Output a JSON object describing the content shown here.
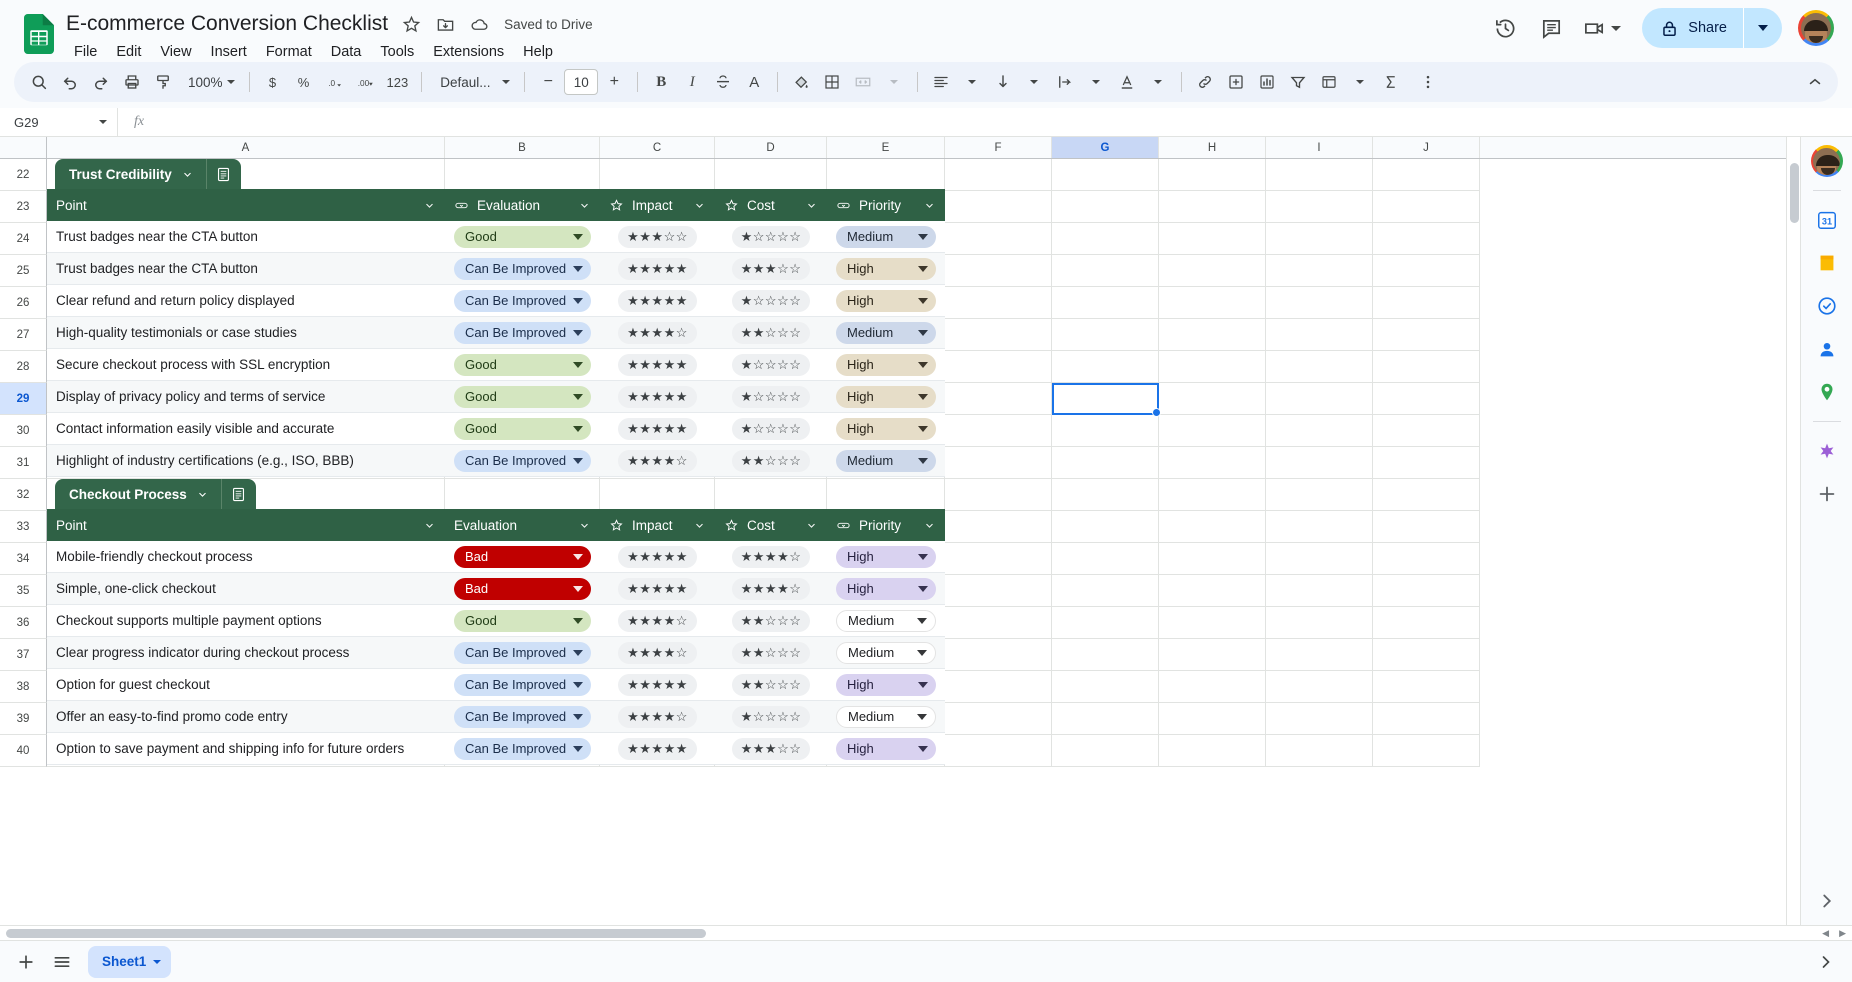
{
  "app": {
    "doc_title": "E-commerce Conversion Checklist",
    "save_status": "Saved to Drive",
    "menus": [
      "File",
      "Edit",
      "View",
      "Insert",
      "Format",
      "Data",
      "Tools",
      "Extensions",
      "Help"
    ],
    "share_label": "Share"
  },
  "toolbar": {
    "zoom": "100%",
    "font": "Defaul...",
    "font_size": "10",
    "number_123": "123",
    "currency": "$",
    "percent": "%",
    "dec_dec": ".0",
    "dec_inc": ".00",
    "bold": "B",
    "italic": "I",
    "text_color": "A",
    "minus": "−",
    "plus": "+"
  },
  "formula_bar": {
    "cell_ref": "G29",
    "formula": ""
  },
  "grid": {
    "columns": [
      "A",
      "B",
      "C",
      "D",
      "E",
      "F",
      "G",
      "H",
      "I",
      "J"
    ],
    "highlighted_column": "G",
    "selected_cell": "G29",
    "rows": [
      "22",
      "23",
      "24",
      "25",
      "26",
      "27",
      "28",
      "29",
      "30",
      "31",
      "32",
      "33",
      "34",
      "35",
      "36",
      "37",
      "38",
      "39",
      "40"
    ],
    "highlighted_row": "29"
  },
  "tables": [
    {
      "name": "Trust Credibility",
      "start_row_index": 0,
      "headers": [
        {
          "label": "Point",
          "icon": "none"
        },
        {
          "label": "Evaluation",
          "icon": "dropdown-chip-icon"
        },
        {
          "label": "Impact",
          "icon": "star-icon"
        },
        {
          "label": "Cost",
          "icon": "star-icon"
        },
        {
          "label": "Priority",
          "icon": "dropdown-chip-icon"
        }
      ],
      "rows": [
        {
          "point": "Trust badges near the CTA button",
          "evaluation": "Good",
          "impact": 3,
          "cost": 1,
          "priority": "Medium"
        },
        {
          "point": "Trust badges near the CTA button",
          "evaluation": "Can Be Improved",
          "impact": 5,
          "cost": 3,
          "priority": "High"
        },
        {
          "point": "Clear refund and return policy displayed",
          "evaluation": "Can Be Improved",
          "impact": 5,
          "cost": 1,
          "priority": "High"
        },
        {
          "point": "High-quality testimonials or case studies",
          "evaluation": "Can Be Improved",
          "impact": 4,
          "cost": 2,
          "priority": "Medium"
        },
        {
          "point": "Secure checkout process with SSL encryption",
          "evaluation": "Good",
          "impact": 5,
          "cost": 1,
          "priority": "High"
        },
        {
          "point": "Display of privacy policy and terms of service",
          "evaluation": "Good",
          "impact": 5,
          "cost": 1,
          "priority": "High"
        },
        {
          "point": "Contact information easily visible and accurate",
          "evaluation": "Good",
          "impact": 5,
          "cost": 1,
          "priority": "High"
        },
        {
          "point": "Highlight of industry certifications (e.g., ISO, BBB)",
          "evaluation": "Can Be Improved",
          "impact": 4,
          "cost": 2,
          "priority": "Medium"
        }
      ]
    },
    {
      "name": "Checkout Process",
      "start_row_index": 10,
      "headers": [
        {
          "label": "Point",
          "icon": "none"
        },
        {
          "label": "Evaluation",
          "icon": "none"
        },
        {
          "label": "Impact",
          "icon": "star-icon"
        },
        {
          "label": "Cost",
          "icon": "star-icon"
        },
        {
          "label": "Priority",
          "icon": "dropdown-chip-icon"
        }
      ],
      "rows": [
        {
          "point": "Mobile-friendly checkout process",
          "evaluation": "Bad",
          "impact": 5,
          "cost": 4,
          "priority": "High"
        },
        {
          "point": "Simple, one-click checkout",
          "evaluation": "Bad",
          "impact": 5,
          "cost": 4,
          "priority": "High"
        },
        {
          "point": "Checkout supports multiple payment options",
          "evaluation": "Good",
          "impact": 4,
          "cost": 2,
          "priority": "Medium"
        },
        {
          "point": "Clear progress indicator during checkout process",
          "evaluation": "Can Be Improved",
          "impact": 4,
          "cost": 2,
          "priority": "Medium"
        },
        {
          "point": "Option for guest checkout",
          "evaluation": "Can Be Improved",
          "impact": 5,
          "cost": 2,
          "priority": "High"
        },
        {
          "point": "Offer an easy-to-find promo code entry",
          "evaluation": "Can Be Improved",
          "impact": 4,
          "cost": 1,
          "priority": "Medium"
        },
        {
          "point": "Option to save payment and shipping info for future orders",
          "evaluation": "Can Be Improved",
          "impact": 5,
          "cost": 3,
          "priority": "High"
        }
      ]
    }
  ],
  "colors": {
    "table_header_bg": "#2f6145",
    "table_chip_bg": "#33664a",
    "good_bg": "#d4e6c0",
    "good_text": "#1e3a14",
    "improved_bg": "#cfe0f7",
    "improved_text": "#1a2d4a",
    "bad_bg": "#c00000",
    "bad_text": "#ffffff",
    "high_bg": "#e6ddc8",
    "high_text": "#2a2418",
    "medium_bg": "#cdd8ea",
    "medium_text": "#1e2733",
    "high_purple_bg": "#d9d2f0",
    "medium_purple_bg": "#ffffff",
    "accent": "#1a73e8",
    "share_bg": "#c2e7ff"
  },
  "bottom": {
    "sheet_name": "Sheet1",
    "add_label": "+",
    "all_sheets_label": "All sheets"
  }
}
